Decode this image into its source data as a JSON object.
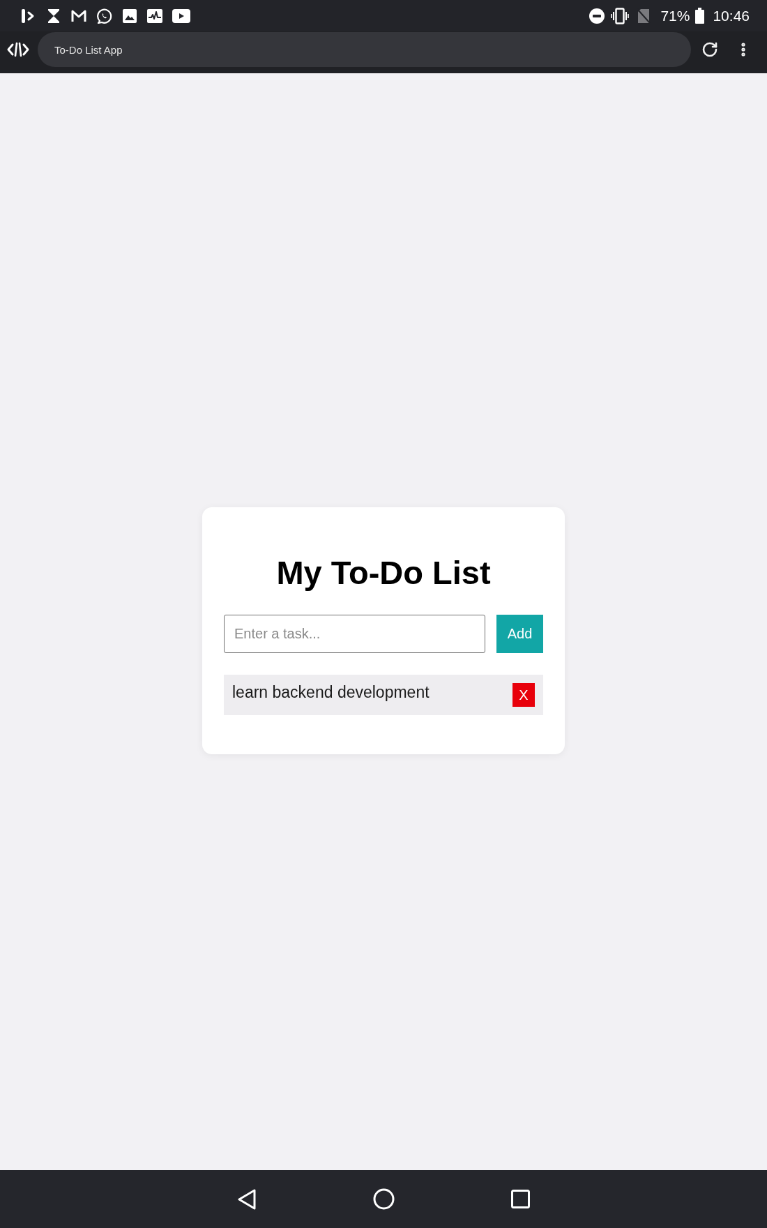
{
  "status_bar": {
    "battery": "71%",
    "time": "10:46"
  },
  "browser_bar": {
    "address": "To-Do List App"
  },
  "app": {
    "title": "My To-Do List",
    "input": {
      "placeholder": "Enter a task..."
    },
    "add_button": "Add",
    "tasks": [
      {
        "text": "learn backend development",
        "delete_label": "X"
      }
    ]
  }
}
